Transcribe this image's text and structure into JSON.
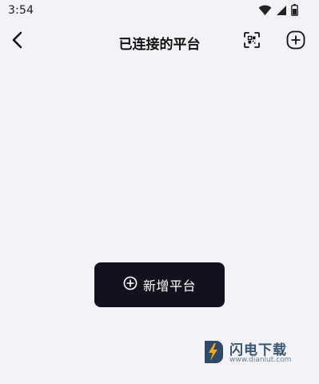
{
  "status_bar": {
    "time": "3:54",
    "icons": [
      "wifi-icon",
      "signal-icon",
      "battery-icon"
    ]
  },
  "header": {
    "title": "已连接的平台",
    "back_icon": "chevron-left-icon",
    "scan_icon": "qr-scan-icon",
    "add_icon": "plus-circle-icon"
  },
  "main": {
    "add_platform_label": "新增平台",
    "add_platform_icon": "plus-circle-icon"
  },
  "watermark": {
    "text": "闪电下载",
    "url": "www.dianlut.com",
    "accent_color": "#f4a71d",
    "badge_color": "#2f4a66"
  },
  "colors": {
    "background": "#f3f2f7",
    "button_dark": "#12121e",
    "text": "#111111"
  }
}
